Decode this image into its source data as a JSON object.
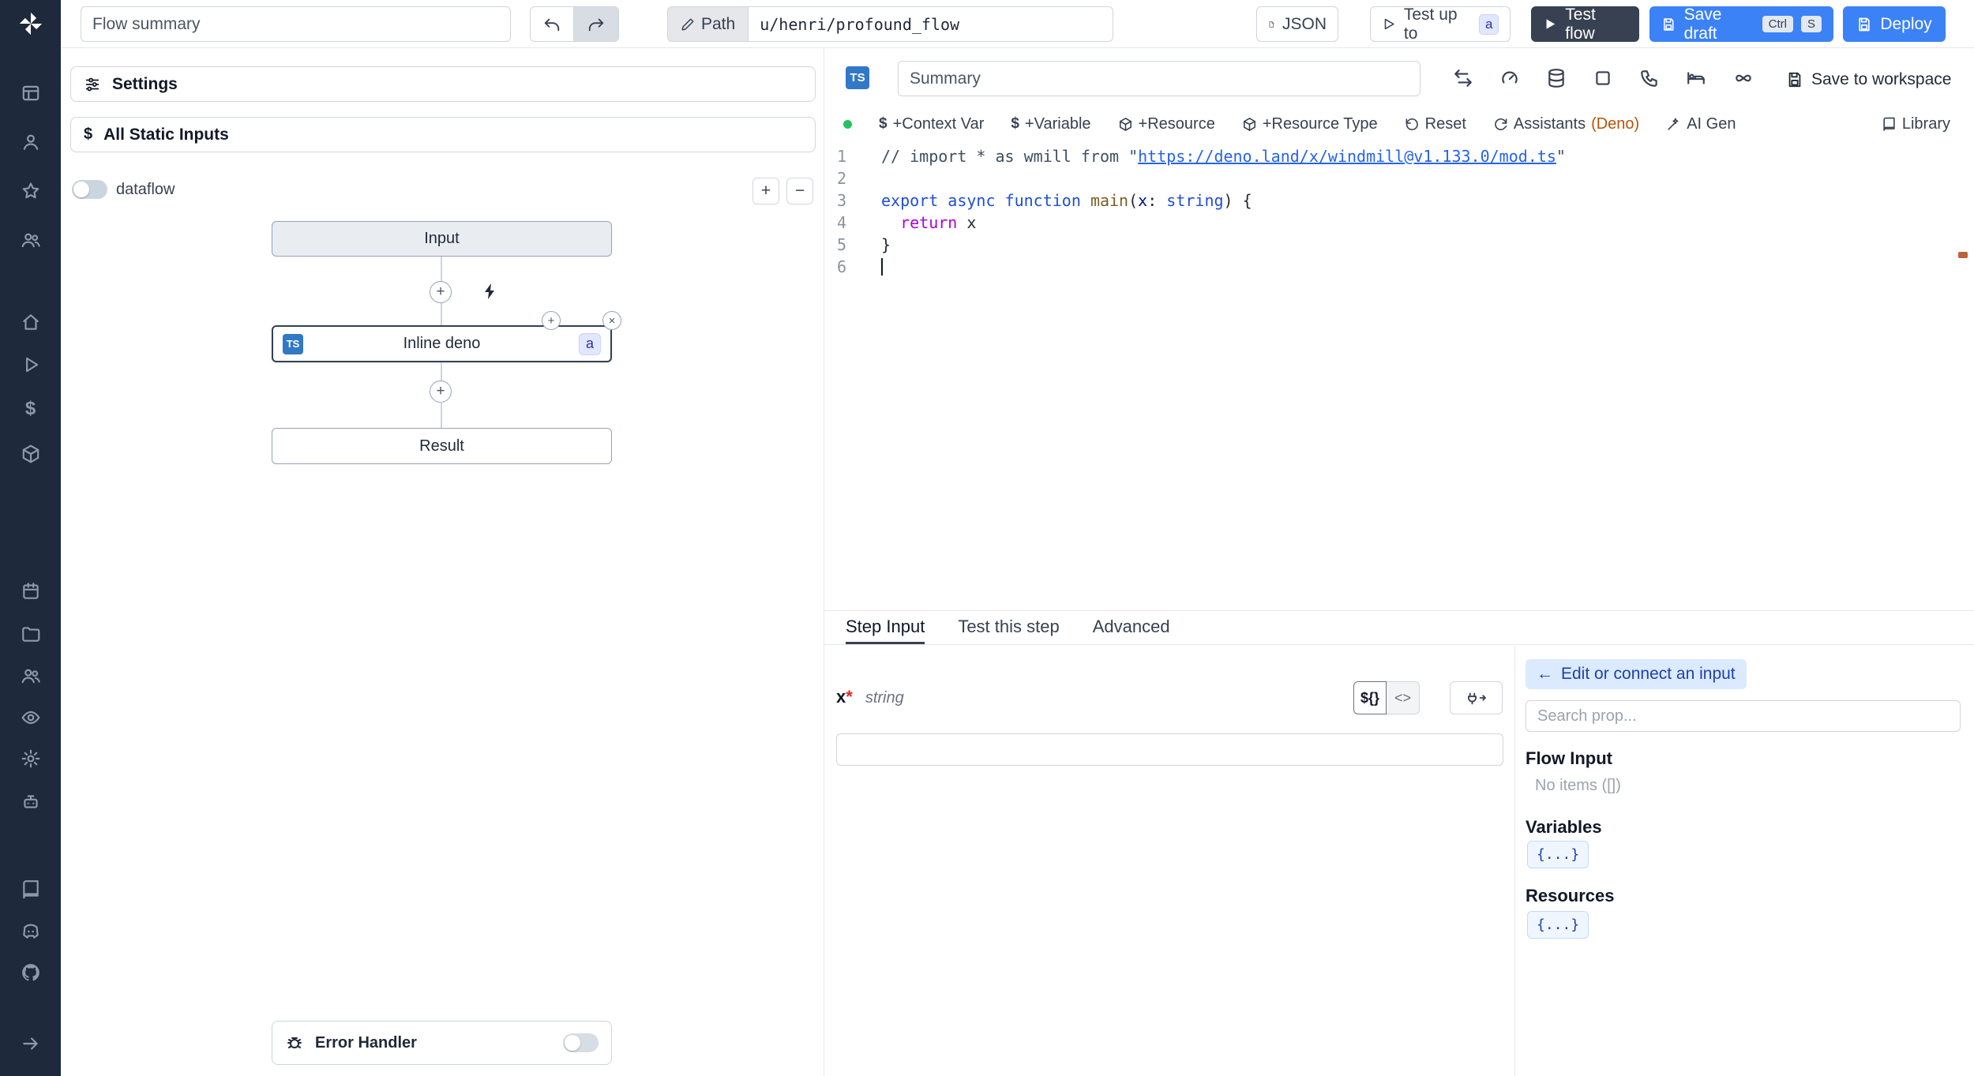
{
  "topbar": {
    "flow_summary_placeholder": "Flow summary",
    "path_label": "Path",
    "path_value": "u/henri/profound_flow",
    "json_label": "JSON",
    "test_up_to_label": "Test up to",
    "test_up_to_badge": "a",
    "test_flow_label": "Test flow",
    "save_draft_label": "Save draft",
    "kbd_ctrl": "Ctrl",
    "kbd_s": "S",
    "deploy_label": "Deploy"
  },
  "flow_panel": {
    "settings_label": "Settings",
    "static_inputs_label": "All Static Inputs",
    "dataflow_label": "dataflow",
    "nodes": {
      "input": "Input",
      "inline": "Inline deno",
      "inline_lang_badge": "TS",
      "inline_suffix_badge": "a",
      "result": "Result"
    },
    "error_handler_label": "Error Handler"
  },
  "editor": {
    "lang_badge": "TS",
    "summary_placeholder": "Summary",
    "save_to_workspace_label": "Save to workspace",
    "toolbar": {
      "context_var": "+Context Var",
      "variable": "+Variable",
      "resource": "+Resource",
      "resource_type": "+Resource Type",
      "reset": "Reset",
      "assistants": "Assistants",
      "assistants_lang": "(Deno)",
      "ai_gen": "AI Gen",
      "library": "Library"
    },
    "code": {
      "cursor_line": 6,
      "lines": [
        [
          {
            "t": "// import * as wmill from \"",
            "c": "cmt"
          },
          {
            "t": "https://deno.land/x/windmill@v1.133.0/mod.ts",
            "c": "lnk"
          },
          {
            "t": "\"",
            "c": "cmt"
          }
        ],
        [],
        [
          {
            "t": "export",
            "c": "kw"
          },
          {
            "t": " ",
            "c": "pl"
          },
          {
            "t": "async",
            "c": "kw"
          },
          {
            "t": " ",
            "c": "pl"
          },
          {
            "t": "function",
            "c": "kw"
          },
          {
            "t": " ",
            "c": "pl"
          },
          {
            "t": "main",
            "c": "fn"
          },
          {
            "t": "(",
            "c": "pl"
          },
          {
            "t": "x",
            "c": "par"
          },
          {
            "t": ": ",
            "c": "pl"
          },
          {
            "t": "string",
            "c": "ty"
          },
          {
            "t": ") {",
            "c": "pl"
          }
        ],
        [
          {
            "t": "  ",
            "c": "pl"
          },
          {
            "t": "return",
            "c": "ctl"
          },
          {
            "t": " x",
            "c": "pl"
          }
        ],
        [
          {
            "t": "}",
            "c": "pl"
          }
        ],
        []
      ]
    }
  },
  "step_panel": {
    "tabs": [
      "Step Input",
      "Test this step",
      "Advanced"
    ],
    "active_tab_index": 0,
    "arg_name": "x",
    "required_mark": "*",
    "arg_type": "string",
    "expr_toggle": "${}",
    "code_toggle": "<>",
    "input_value": ""
  },
  "connect_panel": {
    "back_arrow": "←",
    "edit_connect_label": "Edit or connect an input",
    "search_placeholder": "Search prop...",
    "flow_input_title": "Flow Input",
    "flow_input_empty": "No items ([])",
    "variables_title": "Variables",
    "resources_title": "Resources",
    "object_chip": "{...}"
  },
  "glyphs": {
    "zoom_in": "+",
    "zoom_out": "−",
    "node_add": "+",
    "node_close": "×",
    "dollar": "$"
  },
  "colors": {
    "sidebar_bg": "#1e293b",
    "accent_blue": "#3b82f6",
    "ts_badge_blue": "#3178c6",
    "status_green": "#22c55e",
    "assistants_lang": "#b45309",
    "code_link": "#2563eb"
  }
}
